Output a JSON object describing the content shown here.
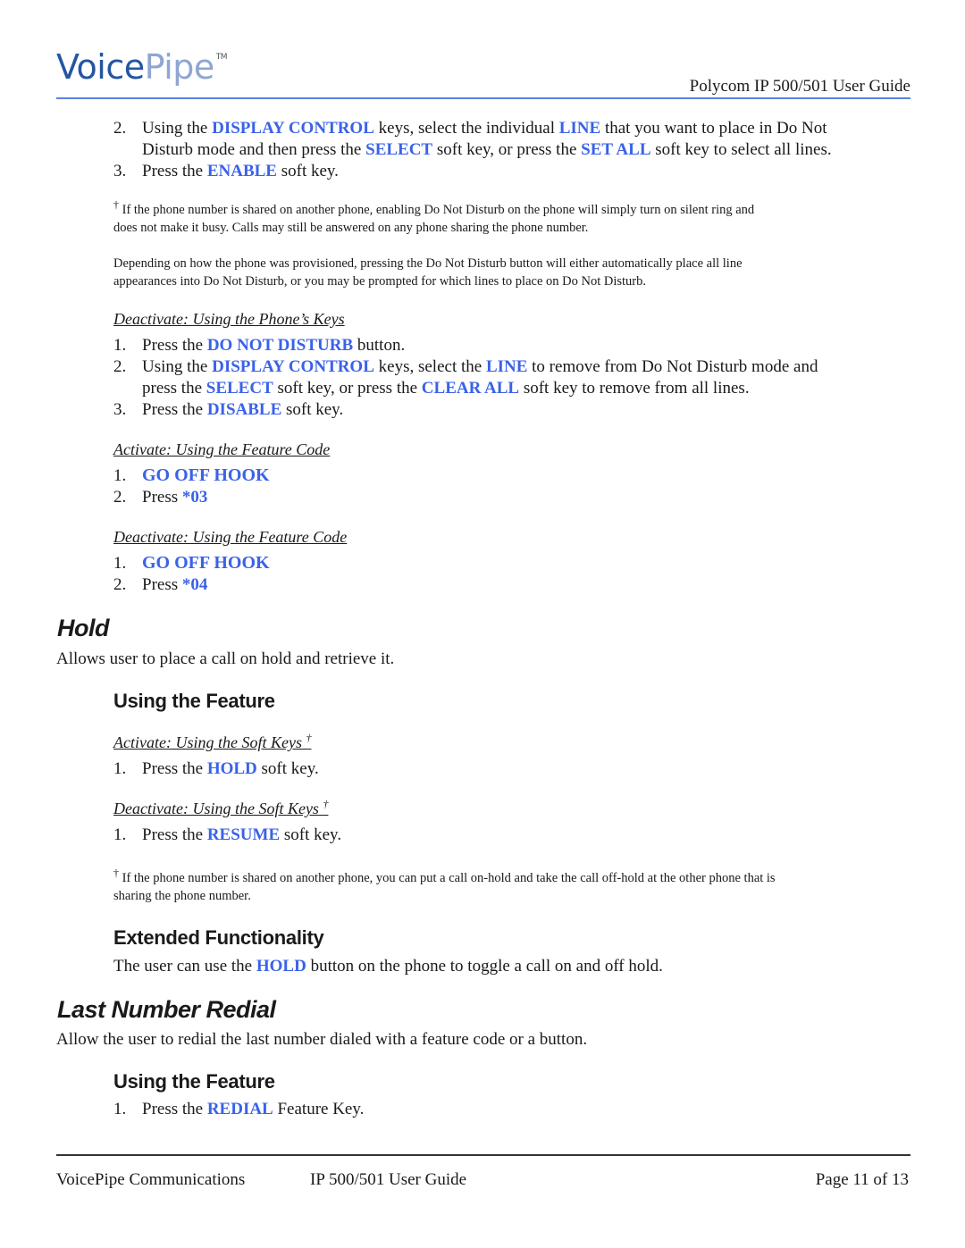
{
  "header": {
    "logo_main": "Voice",
    "logo_accent": "Pipe",
    "logo_tm": "TM",
    "doc_title": "Polycom IP 500/501 User Guide",
    "accent_color": "#5b83e0",
    "keyword_color": "#3a62e8"
  },
  "dnd_cont": {
    "step2": {
      "num": "2.",
      "t1": "Using the ",
      "k1": "DISPLAY CONTROL",
      "t2": " keys, select the individual ",
      "k2": "LINE",
      "t3": " that you want to place in Do Not",
      "t4": "Disturb mode and then press the ",
      "k3": "SELECT",
      "t5": " soft key, or press the ",
      "k4": "SET ALL",
      "t6": " soft key to select all lines."
    },
    "step3": {
      "num": "3.",
      "t1": "Press the ",
      "k1": "ENABLE",
      "t2": " soft key."
    },
    "note1_dagger": "†",
    "note1": "If the phone number is shared on another phone, enabling Do Not Disturb on the phone will simply turn on silent ring and",
    "note1b": "does not make it busy.  Calls may still be answered on any phone sharing the phone number.",
    "note2": "Depending on how the phone was provisioned, pressing the Do Not Disturb button will either automatically place all line",
    "note2b": "appearances into Do Not Disturb, or you may be prompted for which lines to place on Do Not Disturb."
  },
  "dnd_deactivate_keys": {
    "heading": "Deactivate: Using the Phone’s Keys",
    "step1": {
      "num": "1.",
      "t1": "Press the ",
      "k1": "DO NOT DISTURB",
      "t2": " button."
    },
    "step2": {
      "num": "2.",
      "t1": "Using the ",
      "k1": "DISPLAY CONTROL",
      "t2": " keys, select the ",
      "k2": "LINE",
      "t3": " to remove from Do Not Disturb mode and",
      "t4": "press the ",
      "k3": "SELECT",
      "t5": " soft key, or press the ",
      "k4": "CLEAR ALL",
      "t6": " soft key to remove from all lines."
    },
    "step3": {
      "num": "3.",
      "t1": "Press the ",
      "k1": "DISABLE",
      "t2": " soft key."
    }
  },
  "dnd_activate_code": {
    "heading": "Activate: Using the Feature Code",
    "step1": {
      "num": "1.",
      "k1": "GO OFF HOOK"
    },
    "step2": {
      "num": "2.",
      "t1": "Press ",
      "k1": "*03"
    }
  },
  "dnd_deactivate_code": {
    "heading": "Deactivate: Using the Feature Code",
    "step1": {
      "num": "1.",
      "k1": "GO OFF HOOK"
    },
    "step2": {
      "num": "2.",
      "t1": "Press ",
      "k1": "*04"
    }
  },
  "hold": {
    "title": "Hold",
    "desc": "Allows user to place a call on hold and retrieve it.",
    "using_heading": "Using the Feature",
    "activate_heading": "Activate: Using the Soft Keys",
    "activate_step": {
      "num": "1.",
      "t1": "Press the ",
      "k1": "HOLD",
      "t2": " soft key."
    },
    "deactivate_heading": "Deactivate: Using the Soft Keys",
    "deactivate_step": {
      "num": "1.",
      "t1": "Press the ",
      "k1": "RESUME",
      "t2": " soft key."
    },
    "dagger": "†",
    "note": "If the phone number is shared on another phone, you can put a call on-hold and take the call off-hold at the other phone that is",
    "note_b": "sharing the phone number.",
    "ext_heading": "Extended Functionality",
    "ext": {
      "t1": "The user can use the ",
      "k1": "HOLD",
      "t2": " button on the phone to toggle a call on and off hold."
    }
  },
  "redial": {
    "title": "Last Number Redial",
    "desc": "Allow the user to redial the last number dialed with a feature code or a button.",
    "using_heading": "Using the Feature",
    "step": {
      "num": "1.",
      "t1": "Press the ",
      "k1": "REDIAL",
      "t2": " Feature Key."
    }
  },
  "footer": {
    "company": "VoicePipe Communications",
    "guide": "IP 500/501 User Guide",
    "page": "Page 11 of 13"
  }
}
